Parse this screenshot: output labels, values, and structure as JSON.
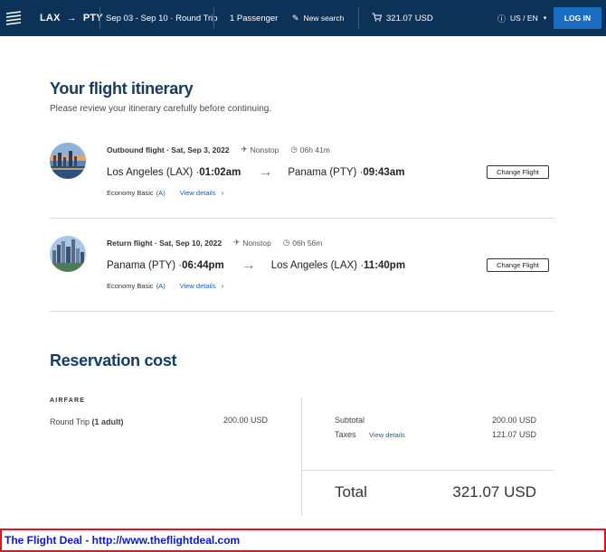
{
  "header": {
    "origin": "LAX",
    "destination": "PTY",
    "dates": "Sep 03 - Sep 10 · Round Trip",
    "passengers": "1 Passenger",
    "new_search": "New search",
    "cart_total": "321.07 USD",
    "locale": "US / EN",
    "login": "LOG IN"
  },
  "itinerary": {
    "title": "Your flight itinerary",
    "subtitle": "Please review your itinerary carefully before continuing."
  },
  "flights": [
    {
      "label": "Outbound flight · Sat, Sep 3, 2022",
      "stops": "Nonstop",
      "duration": "06h 41m",
      "from_city": "Los Angeles (LAX) · ",
      "from_time": "01:02am",
      "to_city": "Panama (PTY) · ",
      "to_time": "09:43am",
      "fare_class": "Economy Basic",
      "fare_code": "(A)",
      "view_details": "View details",
      "change": "Change Flight"
    },
    {
      "label": "Return flight · Sat, Sep 10, 2022",
      "stops": "Nonstop",
      "duration": "06h 56m",
      "from_city": "Panama (PTY) · ",
      "from_time": "06:44pm",
      "to_city": "Los Angeles (LAX) · ",
      "to_time": "11:40pm",
      "fare_class": "Economy Basic",
      "fare_code": "(A)",
      "view_details": "View details",
      "change": "Change Flight"
    }
  ],
  "cost": {
    "title": "Reservation cost",
    "airfare_label": "AIRFARE",
    "trip_label": "Round Trip ",
    "trip_pax": "(1 adult)",
    "trip_value": "200.00 USD",
    "subtotal_label": "Subtotal",
    "subtotal_value": "200.00 USD",
    "taxes_label": "Taxes",
    "taxes_link": "View details",
    "taxes_value": "121.07 USD",
    "total_label": "Total",
    "total_value": "321.07 USD"
  },
  "banner": "The Flight Deal - http://www.theflightdeal.com",
  "colors": {
    "header_bg": "#0d3258",
    "accent": "#1b6dc1",
    "link": "#1b5fb0",
    "banner_border": "#e8101b",
    "banner_text": "#0a1ac6"
  },
  "icons": [
    "airline-logo-icon",
    "arrow-right-icon",
    "pencil-icon",
    "cart-icon",
    "info-icon",
    "chevron-down-icon",
    "plane-icon",
    "clock-icon",
    "chevron-right-icon"
  ]
}
